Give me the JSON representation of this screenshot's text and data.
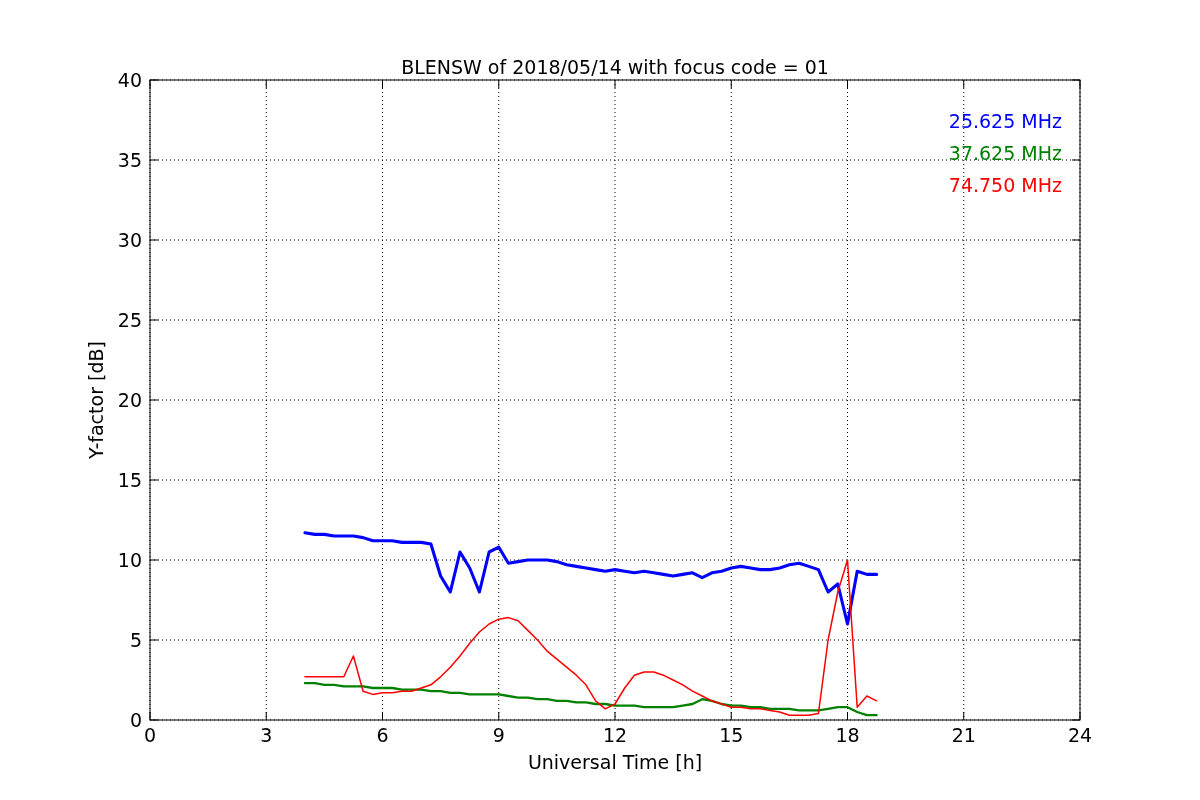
{
  "chart_data": {
    "type": "line",
    "title": "BLENSW of 2018/05/14 with focus code = 01",
    "xlabel": "Universal Time [h]",
    "ylabel": "Y-factor [dB]",
    "x": [
      4,
      4.25,
      4.5,
      4.75,
      5,
      5.25,
      5.5,
      5.75,
      6,
      6.25,
      6.5,
      6.75,
      7,
      7.25,
      7.5,
      7.75,
      8,
      8.25,
      8.5,
      8.75,
      9,
      9.25,
      9.5,
      9.75,
      10,
      10.25,
      10.5,
      10.75,
      11,
      11.25,
      11.5,
      11.75,
      12,
      12.25,
      12.5,
      12.75,
      13,
      13.25,
      13.5,
      13.75,
      14,
      14.25,
      14.5,
      14.75,
      15,
      15.25,
      15.5,
      15.75,
      16,
      16.25,
      16.5,
      16.75,
      17,
      17.25,
      17.5,
      17.75,
      18,
      18.25,
      18.5,
      18.75
    ],
    "series": [
      {
        "name": "25.625 MHz",
        "color": "#0000ff",
        "values": [
          11.7,
          11.6,
          11.6,
          11.5,
          11.5,
          11.5,
          11.4,
          11.2,
          11.2,
          11.2,
          11.1,
          11.1,
          11.1,
          11.0,
          9.0,
          8.0,
          10.5,
          9.5,
          8.0,
          10.5,
          10.8,
          9.8,
          9.9,
          10.0,
          10.0,
          10.0,
          9.9,
          9.7,
          9.6,
          9.5,
          9.4,
          9.3,
          9.4,
          9.3,
          9.2,
          9.3,
          9.2,
          9.1,
          9.0,
          9.1,
          9.2,
          8.9,
          9.2,
          9.3,
          9.5,
          9.6,
          9.5,
          9.4,
          9.4,
          9.5,
          9.7,
          9.8,
          9.6,
          9.4,
          8.0,
          8.5,
          6.0,
          9.3,
          9.1,
          9.1
        ]
      },
      {
        "name": "37.625 MHz",
        "color": "#008000",
        "values": [
          2.3,
          2.3,
          2.2,
          2.2,
          2.1,
          2.1,
          2.1,
          2.0,
          2.0,
          2.0,
          1.9,
          1.9,
          1.9,
          1.8,
          1.8,
          1.7,
          1.7,
          1.6,
          1.6,
          1.6,
          1.6,
          1.5,
          1.4,
          1.4,
          1.3,
          1.3,
          1.2,
          1.2,
          1.1,
          1.1,
          1.0,
          1.0,
          0.9,
          0.9,
          0.9,
          0.8,
          0.8,
          0.8,
          0.8,
          0.9,
          1.0,
          1.3,
          1.2,
          1.0,
          0.9,
          0.9,
          0.8,
          0.8,
          0.7,
          0.7,
          0.7,
          0.6,
          0.6,
          0.6,
          0.7,
          0.8,
          0.8,
          0.5,
          0.3,
          0.3
        ]
      },
      {
        "name": "74.750 MHz",
        "color": "#ff0000",
        "values": [
          2.7,
          2.7,
          2.7,
          2.7,
          2.7,
          4.0,
          1.8,
          1.6,
          1.7,
          1.7,
          1.8,
          1.8,
          2.0,
          2.2,
          2.7,
          3.3,
          4.0,
          4.8,
          5.5,
          6.0,
          6.3,
          6.4,
          6.2,
          5.6,
          5.0,
          4.3,
          3.8,
          3.3,
          2.8,
          2.2,
          1.2,
          0.7,
          1.0,
          2.0,
          2.8,
          3.0,
          3.0,
          2.8,
          2.5,
          2.2,
          1.8,
          1.5,
          1.2,
          1.0,
          0.8,
          0.8,
          0.7,
          0.7,
          0.6,
          0.5,
          0.3,
          0.3,
          0.3,
          0.4,
          5.0,
          8.0,
          10.0,
          0.8,
          1.5,
          1.2
        ]
      }
    ],
    "grid": true,
    "xlim": [
      0,
      24
    ],
    "ylim": [
      0,
      40
    ],
    "xticks": [
      0,
      3,
      6,
      9,
      12,
      15,
      18,
      21,
      24
    ],
    "yticks": [
      0,
      5,
      10,
      15,
      20,
      25,
      30,
      35,
      40
    ]
  }
}
